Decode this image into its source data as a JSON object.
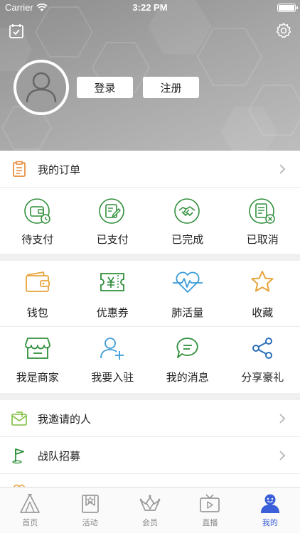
{
  "status_bar": {
    "carrier": "Carrier",
    "time": "3:22 PM"
  },
  "header": {
    "login_label": "登录",
    "register_label": "注册"
  },
  "orders": {
    "title": "我的订单",
    "statuses": [
      {
        "label": "待支付",
        "icon": "wallet-clock-icon"
      },
      {
        "label": "已支付",
        "icon": "document-edit-icon"
      },
      {
        "label": "已完成",
        "icon": "handshake-icon"
      },
      {
        "label": "已取消",
        "icon": "document-cancel-icon"
      }
    ]
  },
  "services": [
    {
      "label": "钱包",
      "icon": "wallet-icon",
      "color": "#e8a33a"
    },
    {
      "label": "优惠券",
      "icon": "coupon-icon",
      "color": "#2f8f3a"
    },
    {
      "label": "肺活量",
      "icon": "heartbeat-icon",
      "color": "#3a9bd8"
    },
    {
      "label": "收藏",
      "icon": "star-icon",
      "color": "#e8a33a"
    },
    {
      "label": "我是商家",
      "icon": "store-icon",
      "color": "#2f8f3a"
    },
    {
      "label": "我要入驻",
      "icon": "user-add-icon",
      "color": "#3a9bd8"
    },
    {
      "label": "我的消息",
      "icon": "message-icon",
      "color": "#2f8f3a"
    },
    {
      "label": "分享豪礼",
      "icon": "share-icon",
      "color": "#2a6fb8"
    }
  ],
  "links": [
    {
      "label": "我邀请的人",
      "icon": "mail-invite-icon"
    },
    {
      "label": "战队招募",
      "icon": "flag-icon"
    }
  ],
  "tabs": [
    {
      "label": "首页",
      "icon": "home-tent-icon",
      "active": false
    },
    {
      "label": "活动",
      "icon": "activity-bookmark-icon",
      "active": false
    },
    {
      "label": "会员",
      "icon": "member-crown-icon",
      "active": false
    },
    {
      "label": "直播",
      "icon": "live-tv-icon",
      "active": false
    },
    {
      "label": "我的",
      "icon": "profile-icon",
      "active": true
    }
  ],
  "colors": {
    "accent_green": "#2f8f3a",
    "accent_blue": "#3a5fd8",
    "accent_orange": "#e8a33a"
  }
}
